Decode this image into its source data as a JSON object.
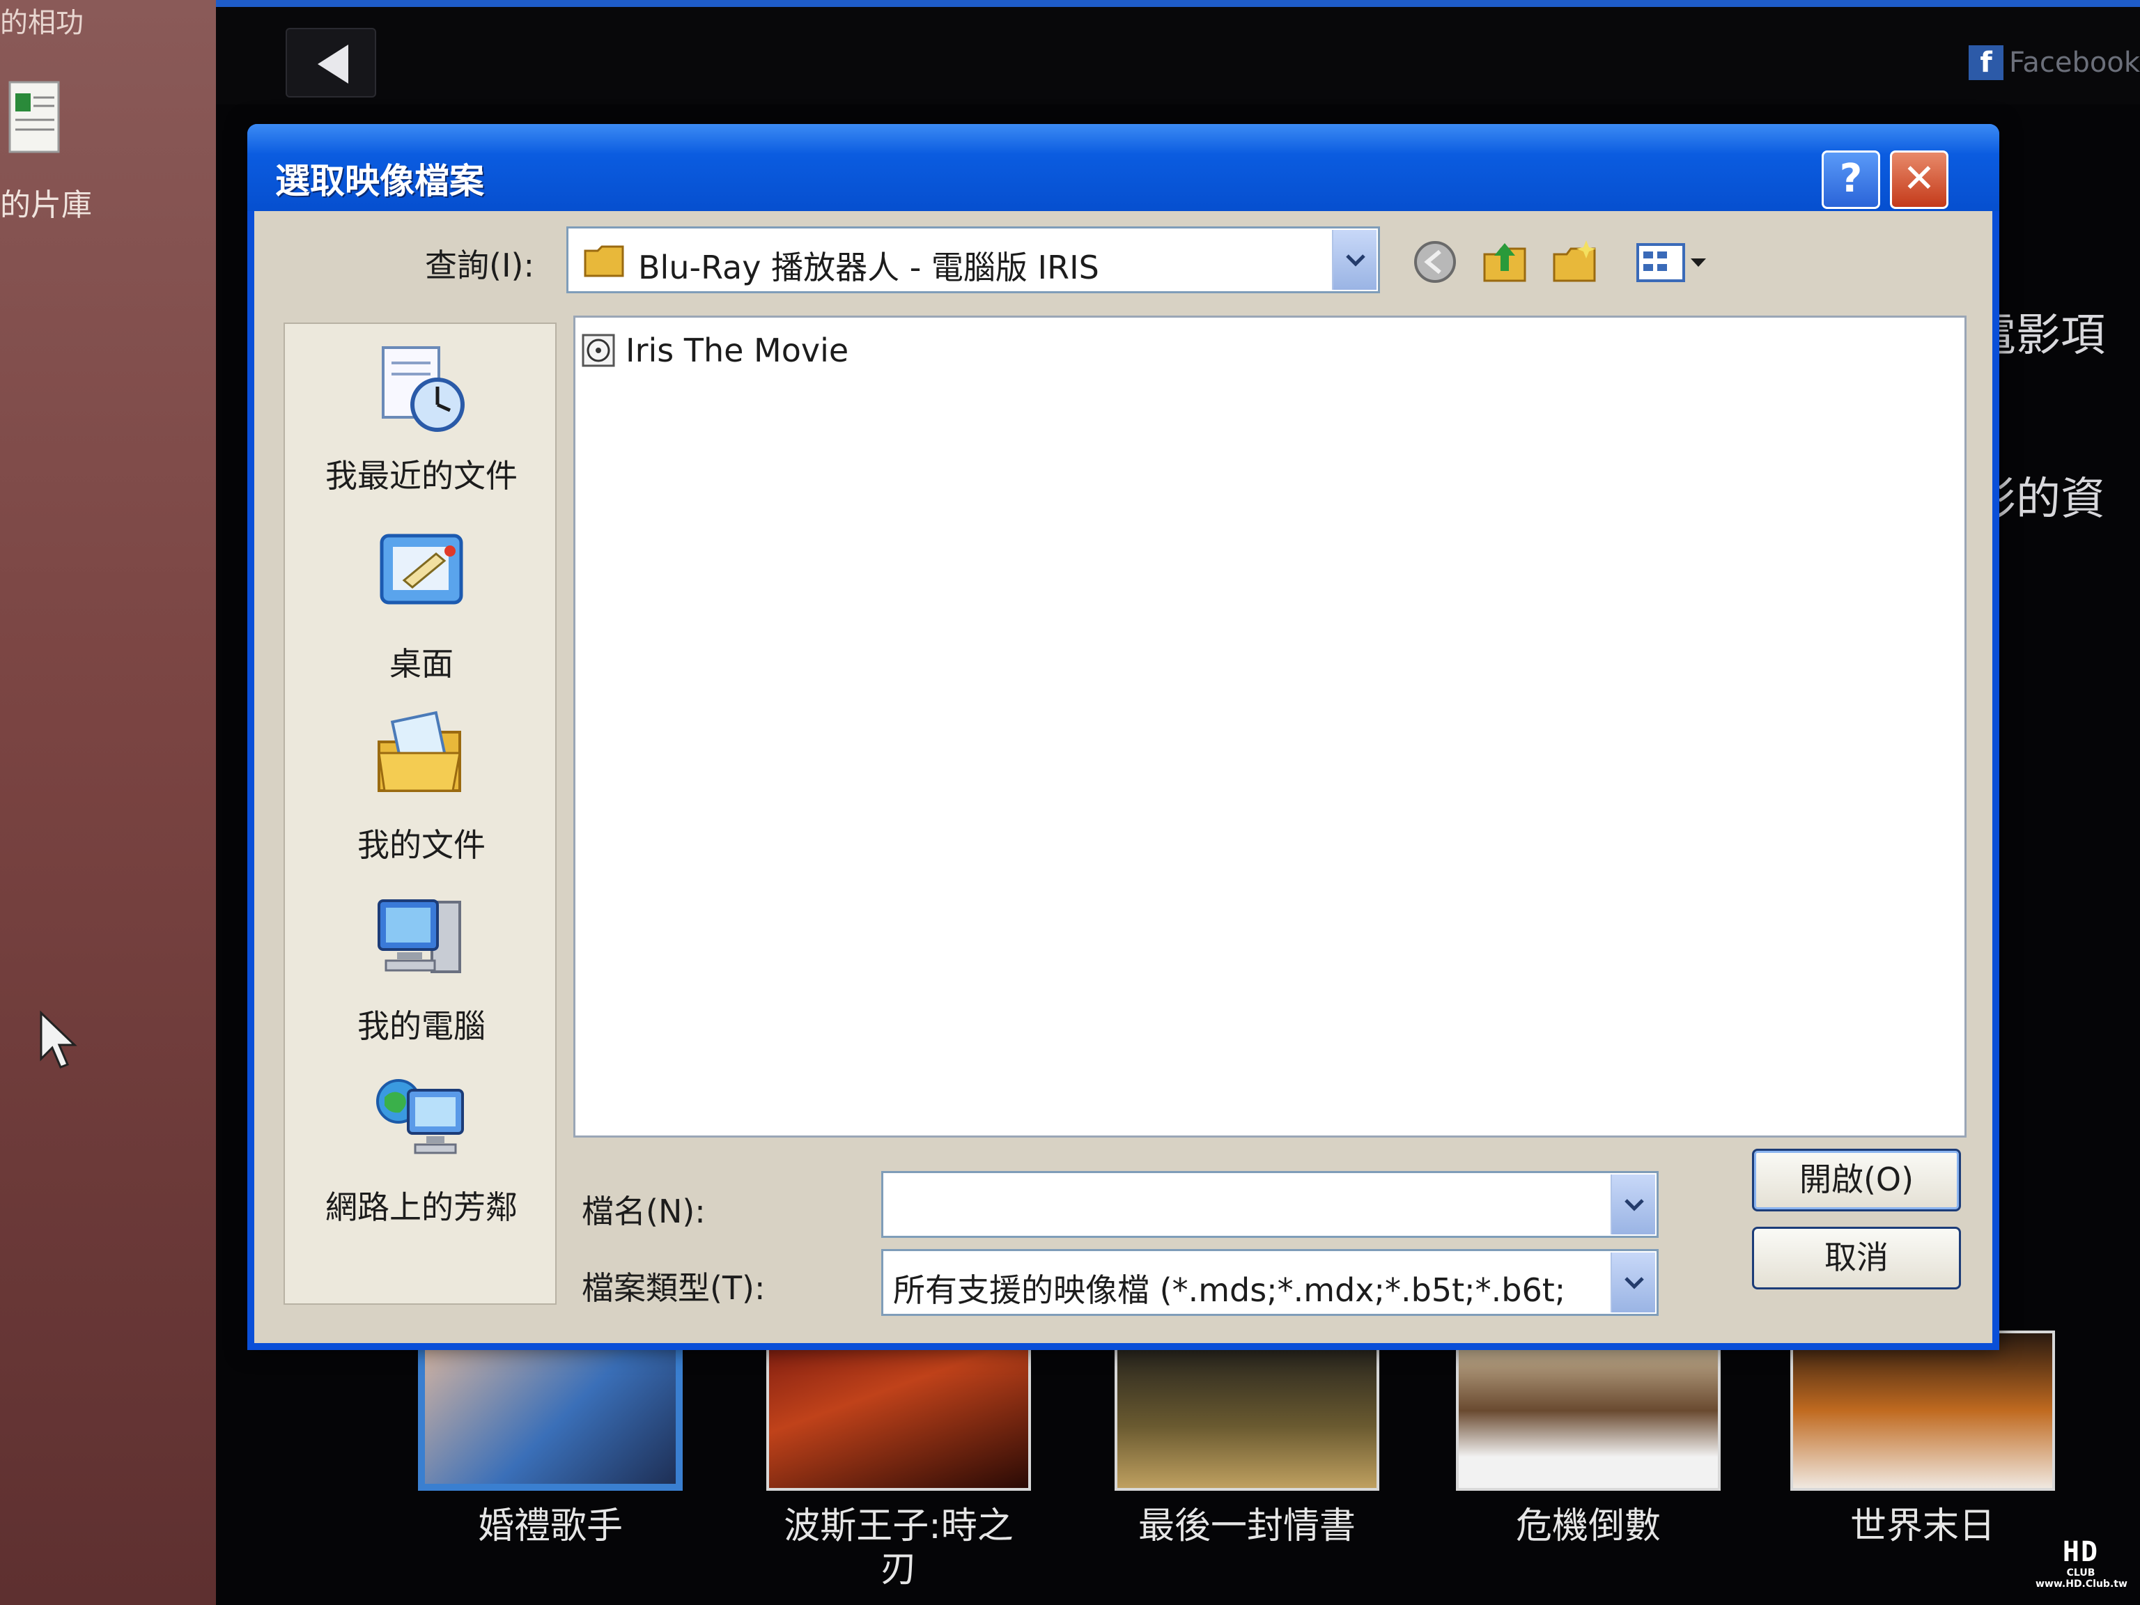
{
  "desktop": {
    "top_label": "的相功",
    "shortcut_label": "的片庫"
  },
  "app": {
    "facebook_text": "Facebook",
    "side_text_1": "電影項",
    "side_text_2": "影的資",
    "movies": [
      {
        "title": "婚禮歌手"
      },
      {
        "title": "波斯王子:時之刃"
      },
      {
        "title": "最後一封情書"
      },
      {
        "title": "危機倒數"
      },
      {
        "title": "世界末日"
      }
    ],
    "logo_big": "HD",
    "logo_small": "CLUB",
    "logo_url": "www.HD.Club.tw"
  },
  "dialog": {
    "title": "選取映像檔案",
    "help_label": "?",
    "close_label": "✕",
    "lookin_label": "查詢(I):",
    "lookin_value": "Blu-Ray 播放器人 - 電腦版 IRIS",
    "places": [
      {
        "label": "我最近的文件"
      },
      {
        "label": "桌面"
      },
      {
        "label": "我的文件"
      },
      {
        "label": "我的電腦"
      },
      {
        "label": "網路上的芳鄰"
      }
    ],
    "files": [
      {
        "name": "Iris The Movie"
      }
    ],
    "filename_label": "檔名(N):",
    "filename_value": "",
    "filetype_label": "檔案類型(T):",
    "filetype_value": "所有支援的映像檔 (*.mds;*.mdx;*.b5t;*.b6t;",
    "open_label": "開啟(O)",
    "cancel_label": "取消"
  },
  "colors": {
    "titlebar": "#0b5ce0",
    "dialog_face": "#d8d2c4",
    "accent": "#1e5cc9"
  }
}
